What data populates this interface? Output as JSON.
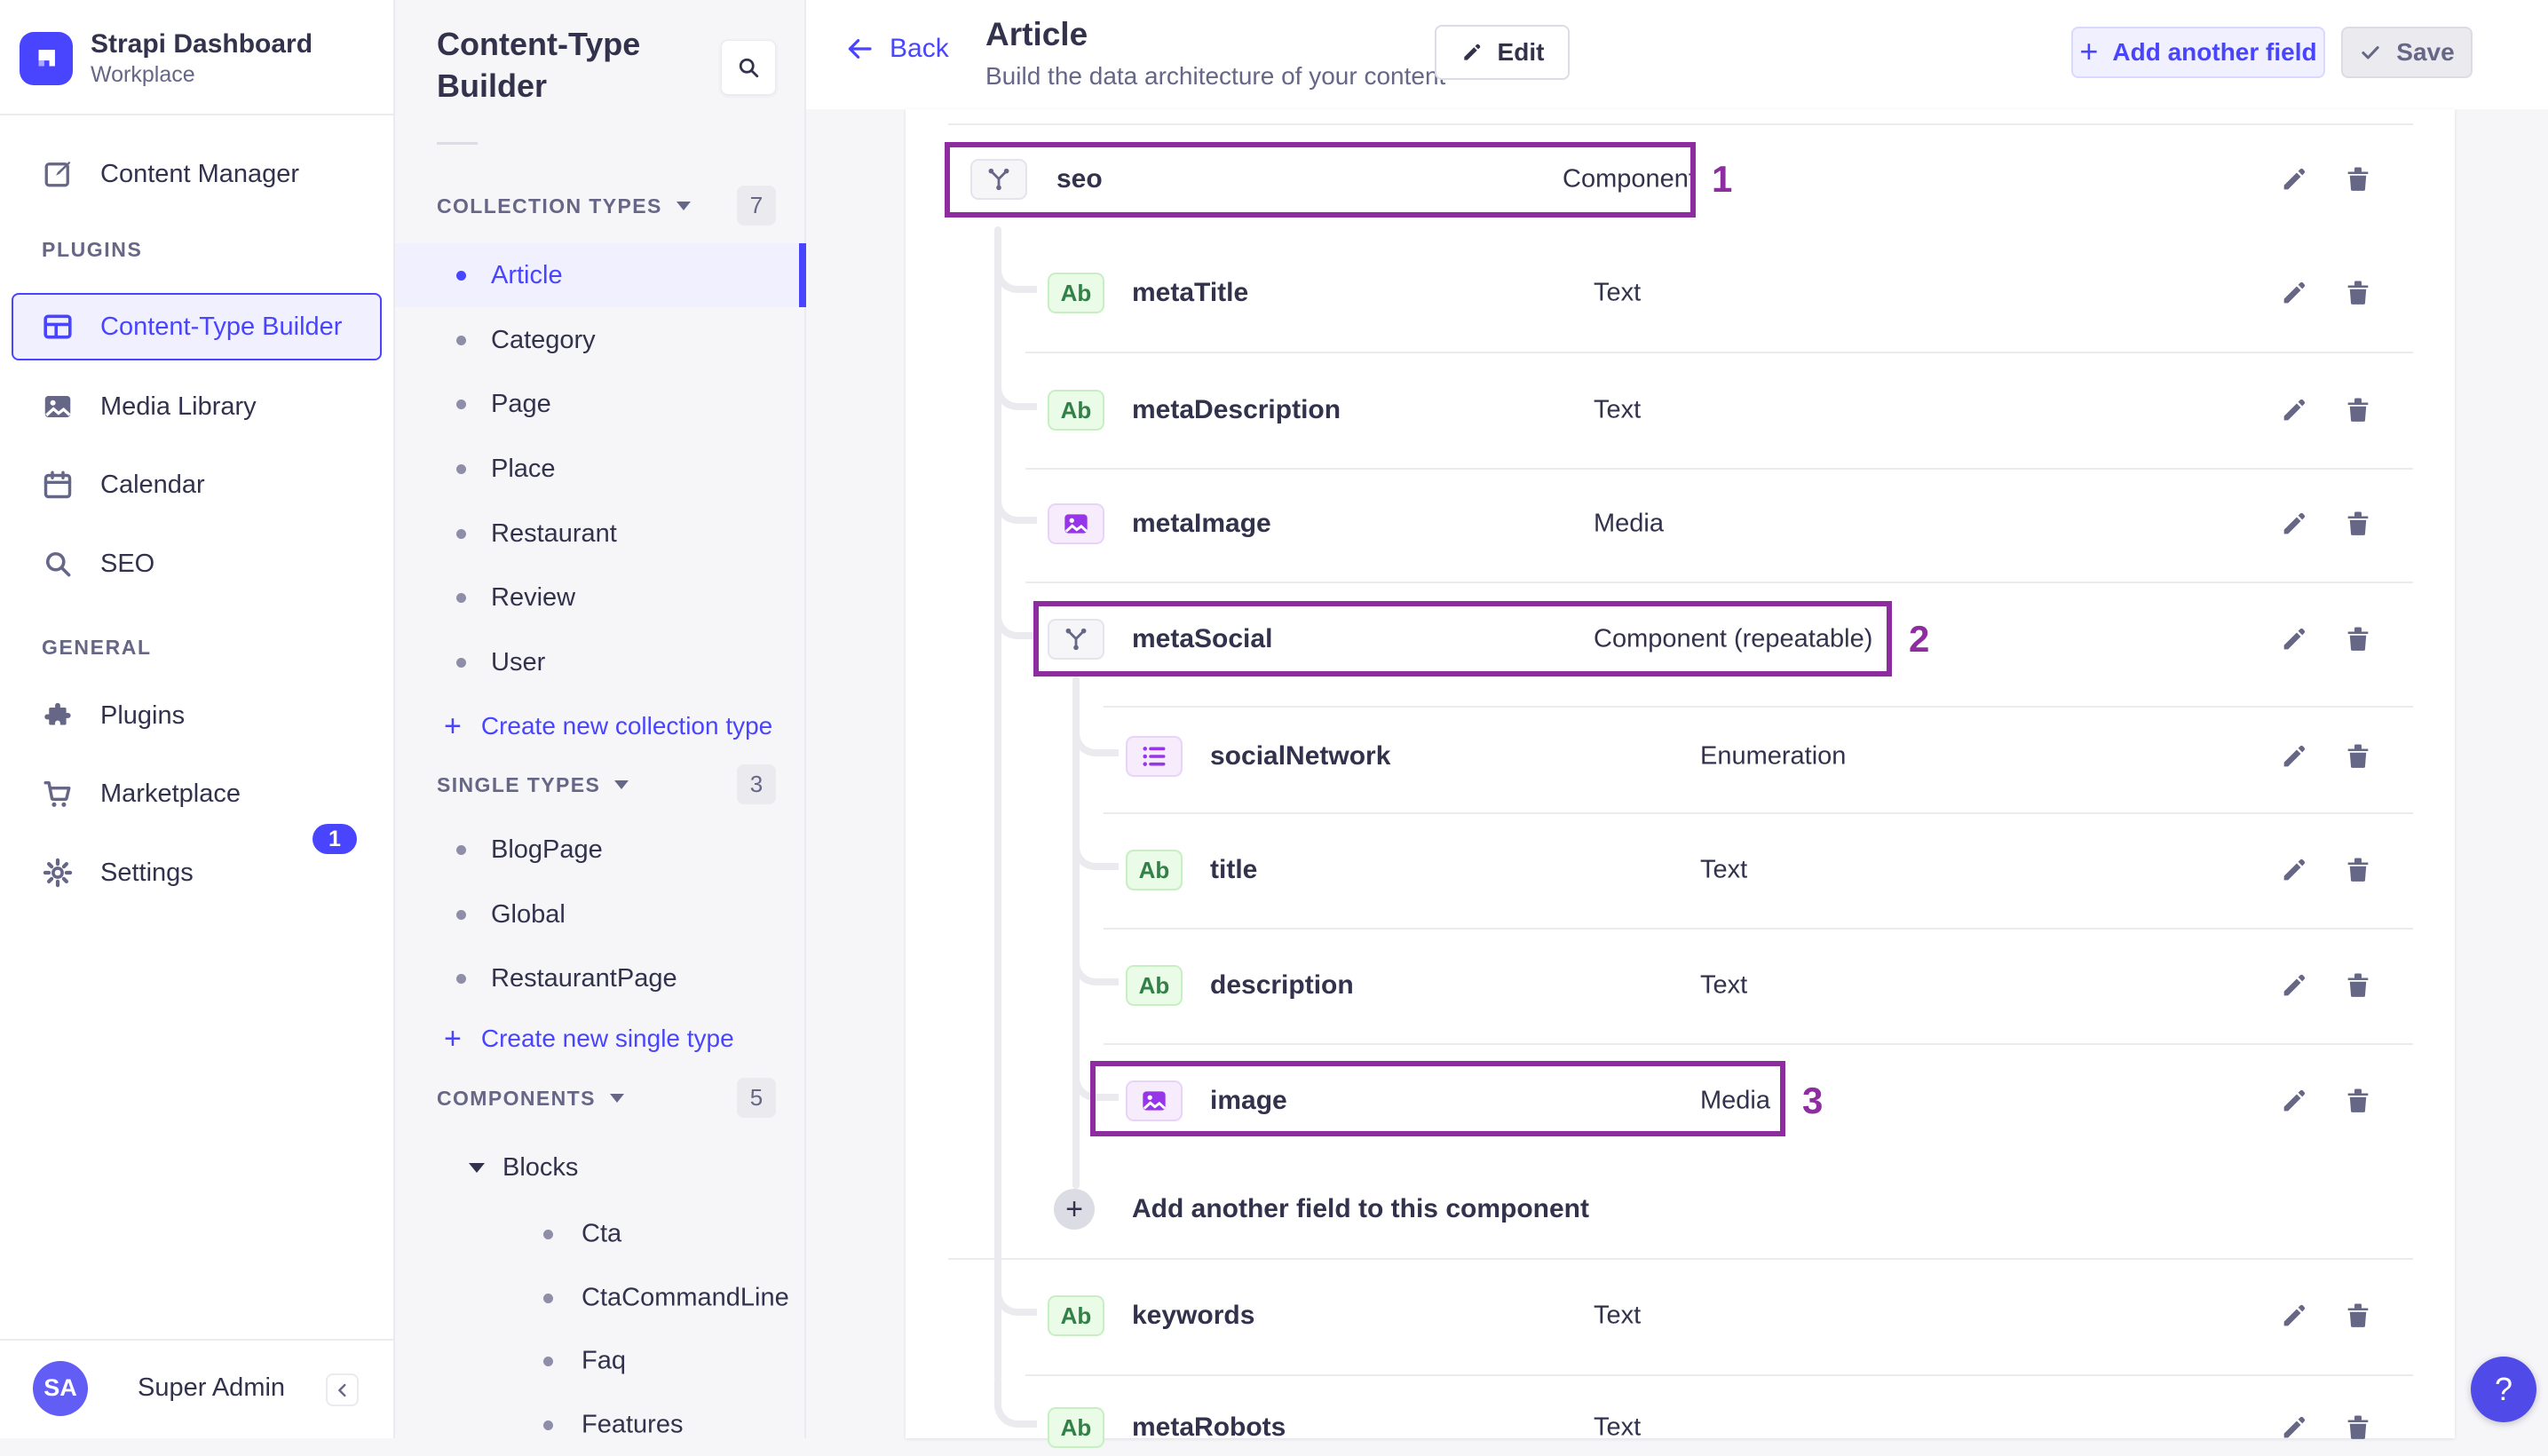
{
  "brand": {
    "name": "Strapi Dashboard",
    "workspace": "Workplace",
    "logo_icon": "strapi-logo-icon"
  },
  "left_nav": {
    "top_item": {
      "label": "Content Manager",
      "icon": "content-manager-icon"
    },
    "sections": [
      {
        "title": "PLUGINS",
        "items": [
          {
            "label": "Content-Type Builder",
            "icon": "content-type-builder-icon",
            "active": true
          },
          {
            "label": "Media Library",
            "icon": "media-library-icon"
          },
          {
            "label": "Calendar",
            "icon": "calendar-icon"
          },
          {
            "label": "SEO",
            "icon": "search-icon"
          }
        ]
      },
      {
        "title": "GENERAL",
        "items": [
          {
            "label": "Plugins",
            "icon": "puzzle-icon"
          },
          {
            "label": "Marketplace",
            "icon": "cart-icon"
          },
          {
            "label": "Settings",
            "icon": "gear-icon",
            "badge": "1"
          }
        ]
      }
    ],
    "user": {
      "initials": "SA",
      "name": "Super Admin",
      "collapse_icon": "chevron-left-icon"
    }
  },
  "ctb_panel": {
    "title": "Content-Type Builder",
    "search_icon": "search-icon",
    "groups": [
      {
        "label": "COLLECTION TYPES",
        "count": "7",
        "items": [
          "Article",
          "Category",
          "Page",
          "Place",
          "Restaurant",
          "Review",
          "User"
        ],
        "selected": "Article",
        "action": "Create new collection type"
      },
      {
        "label": "SINGLE TYPES",
        "count": "3",
        "items": [
          "BlogPage",
          "Global",
          "RestaurantPage"
        ],
        "action": "Create new single type"
      },
      {
        "label": "COMPONENTS",
        "count": "5",
        "tree": {
          "parent": "Blocks",
          "children": [
            "Cta",
            "CtaCommandLine",
            "Faq",
            "Features"
          ]
        }
      }
    ]
  },
  "header": {
    "back": "Back",
    "title": "Article",
    "subtitle": "Build the data architecture of your content",
    "edit": "Edit",
    "add_field": "Add another field",
    "save": "Save"
  },
  "fields": [
    {
      "name": "seo",
      "type": "Component",
      "kind": "component",
      "level": 0,
      "annotation": "1"
    },
    {
      "name": "metaTitle",
      "type": "Text",
      "kind": "text",
      "level": 1
    },
    {
      "name": "metaDescription",
      "type": "Text",
      "kind": "text",
      "level": 1
    },
    {
      "name": "metaImage",
      "type": "Media",
      "kind": "media",
      "level": 1
    },
    {
      "name": "metaSocial",
      "type": "Component (repeatable)",
      "kind": "component",
      "level": 1,
      "annotation": "2"
    },
    {
      "name": "socialNetwork",
      "type": "Enumeration",
      "kind": "enum",
      "level": 2
    },
    {
      "name": "title",
      "type": "Text",
      "kind": "text",
      "level": 2
    },
    {
      "name": "description",
      "type": "Text",
      "kind": "text",
      "level": 2
    },
    {
      "name": "image",
      "type": "Media",
      "kind": "media",
      "level": 2,
      "annotation": "3"
    },
    {
      "add_row": true,
      "label": "Add another field to this component"
    },
    {
      "name": "keywords",
      "type": "Text",
      "kind": "text",
      "level": 1
    },
    {
      "name": "metaRobots",
      "type": "Text",
      "kind": "text",
      "level": 1
    }
  ],
  "badge_labels": {
    "text": "Ab"
  },
  "row_actions": {
    "edit_icon": "pencil-icon",
    "delete_icon": "trash-icon"
  },
  "help": "?",
  "colors": {
    "primary": "#4945FF",
    "primary_bg": "#F0F0FF",
    "annotation": "#8E2DA0",
    "success_text": "#328048",
    "success_bg": "#EAFBE7",
    "alt_purple": "#9736E8",
    "neutral_bg": "#F6F6F9",
    "divider": "#EAEAEF",
    "text_dark": "#32324D",
    "text_gray": "#666687"
  }
}
